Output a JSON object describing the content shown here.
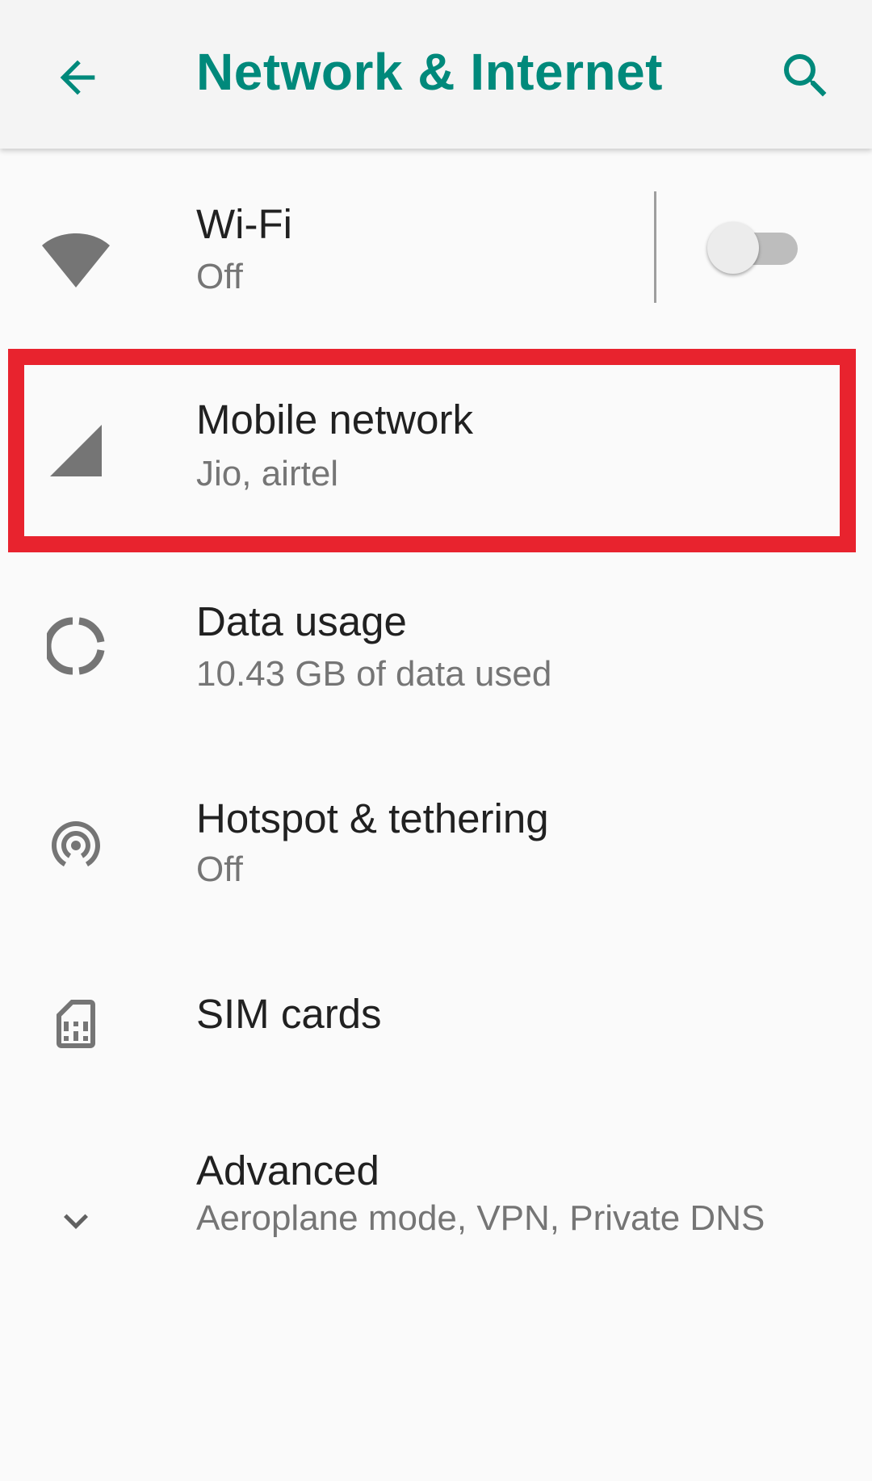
{
  "app_bar": {
    "title": "Network & Internet",
    "back_icon": "arrow-back-icon",
    "search_icon": "search-icon",
    "accent_color": "#00897b"
  },
  "items": [
    {
      "key": "wifi",
      "icon": "wifi-icon",
      "title": "Wi-Fi",
      "summary": "Off",
      "toggle_on": false
    },
    {
      "key": "mobile_network",
      "icon": "cellular-signal-icon",
      "title": "Mobile network",
      "summary": "Jio, airtel",
      "highlighted": true
    },
    {
      "key": "data_usage",
      "icon": "data-usage-icon",
      "title": "Data usage",
      "summary": "10.43 GB of data used"
    },
    {
      "key": "hotspot",
      "icon": "hotspot-icon",
      "title": "Hotspot & tethering",
      "summary": "Off"
    },
    {
      "key": "sim_cards",
      "icon": "sim-card-icon",
      "title": "SIM cards"
    },
    {
      "key": "advanced",
      "icon": "chevron-down-icon",
      "title": "Advanced",
      "summary": "Aeroplane mode, VPN, Private DNS"
    }
  ],
  "highlight_color": "#e8232e"
}
